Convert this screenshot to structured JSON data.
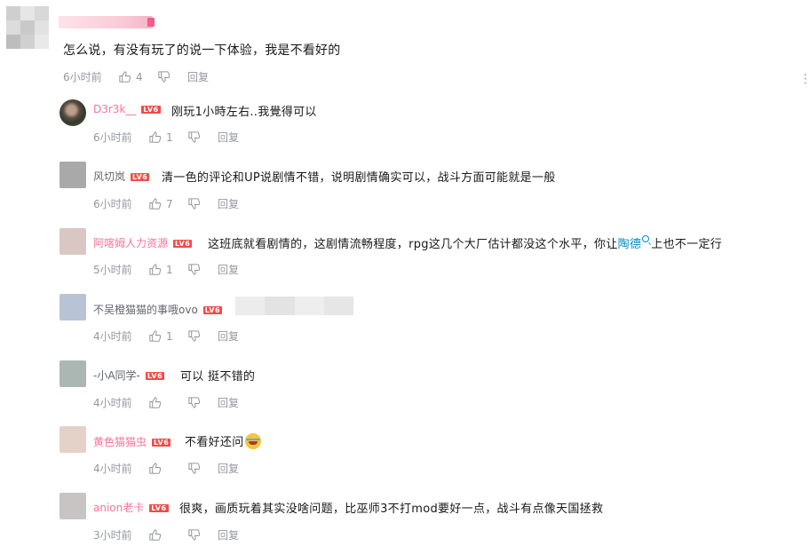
{
  "top_comment": {
    "text": "怎么说，有没有玩了的说一下体验，我是不看好的",
    "time": "6小时前",
    "likes": "4",
    "reply_label": "回复",
    "more_icon": "more-dots-icon"
  },
  "colors": {
    "meta_gray": "#9499a0",
    "pink_name": "#fb7299",
    "default_name": "#61666d",
    "level_badge": "#f04c49",
    "link_blue": "#008ac5"
  },
  "replies": [
    {
      "name": "D3r3k__",
      "level": "LV6",
      "name_color": "pink",
      "text": "刚玩1小時左右..我覺得可以",
      "time": "6小时前",
      "likes": "1",
      "reply_label": "回复"
    },
    {
      "name": "风切岚",
      "level": "LV6",
      "name_color": "default",
      "text": "清一色的评论和UP说剧情不错，说明剧情确实可以，战斗方面可能就是一般",
      "time": "6小时前",
      "likes": "7",
      "reply_label": "回复"
    },
    {
      "name": "阿喀姆人力资源",
      "level": "LV6",
      "name_color": "pink",
      "text_before": "这班底就看剧情的，这剧情流畅程度，rpg这几个大厂估计都没这个水平，你让",
      "link_text": "陶德",
      "text_after": "上也不一定行",
      "time": "5小时前",
      "likes": "1",
      "reply_label": "回复"
    },
    {
      "name": "不吴橙猫猫的事哦ovo",
      "level": "LV6",
      "name_color": "default",
      "text": "",
      "time": "4小时前",
      "likes": "1",
      "reply_label": "回复"
    },
    {
      "name": "-小A同学-",
      "level": "LV6",
      "name_color": "default",
      "text": "可以 挺不错的",
      "time": "4小时前",
      "likes": "",
      "reply_label": "回复"
    },
    {
      "name": "黄色猫猫虫",
      "level": "LV6",
      "name_color": "pink",
      "text": "不看好还问",
      "emoji": "laughing-tears-emoji",
      "time": "4小时前",
      "likes": "",
      "reply_label": "回复"
    },
    {
      "name": "anion老卡",
      "level": "LV6",
      "name_color": "pink",
      "text": "很爽，画质玩着其实没啥问题，比巫师3不打mod要好一点，战斗有点像天国拯救",
      "time": "3小时前",
      "likes": "",
      "reply_label": "回复"
    }
  ]
}
